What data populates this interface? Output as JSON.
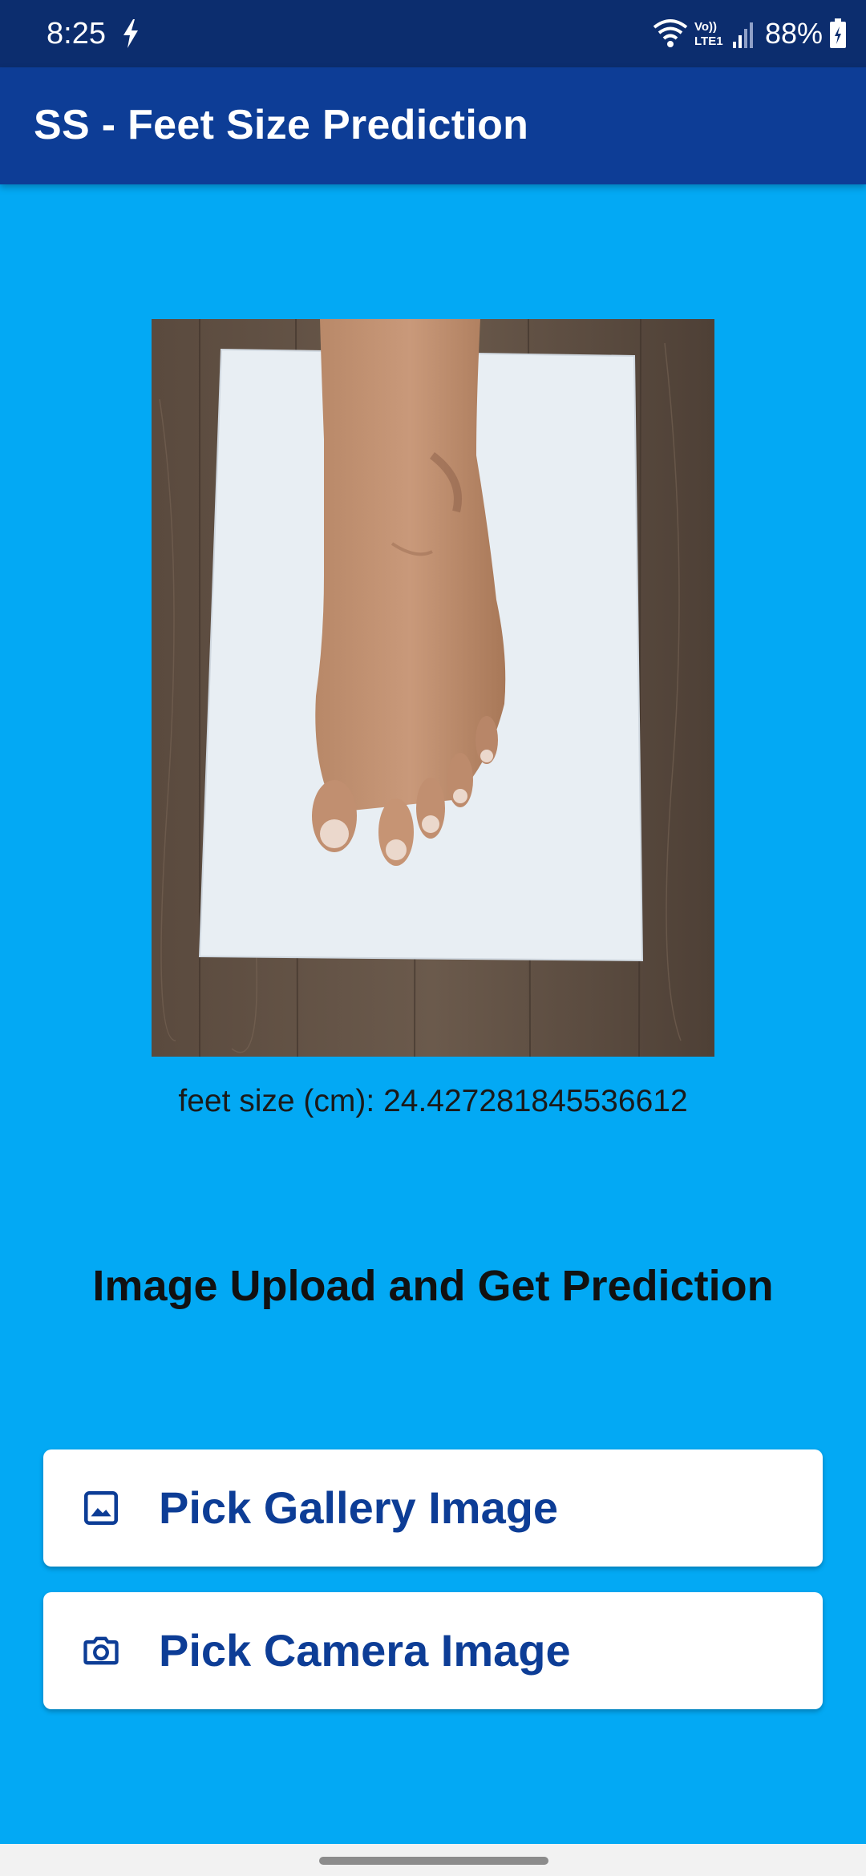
{
  "status_bar": {
    "time": "8:25",
    "battery": "88%",
    "icons": [
      "charging-bolt-icon",
      "wifi-icon",
      "volte-icon",
      "signal-icon",
      "battery-icon"
    ]
  },
  "app_bar": {
    "title": "SS - Feet Size Prediction"
  },
  "preview": {
    "image_description": "foot on white paper over wooden floor"
  },
  "result": {
    "text": "feet size (cm): 24.427281845536612"
  },
  "section": {
    "title": "Image Upload and Get Prediction"
  },
  "buttons": {
    "gallery": {
      "label": "Pick Gallery Image",
      "icon": "image-icon"
    },
    "camera": {
      "label": "Pick Camera Image",
      "icon": "camera-icon"
    }
  },
  "colors": {
    "background": "#03A9F4",
    "status_bar": "#0C2D6E",
    "app_bar": "#0D3D96",
    "button_text": "#0D3D96",
    "button_bg": "#FFFFFF"
  }
}
